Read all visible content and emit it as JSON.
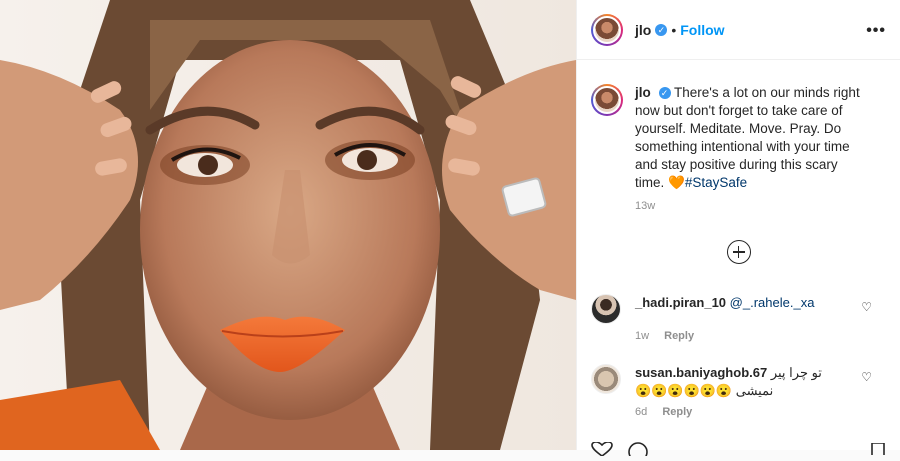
{
  "post": {
    "username": "jlo",
    "verified_mark": "✓",
    "separator": "•",
    "follow_label": "Follow",
    "more_label": "•••",
    "caption_text": "There's a lot on our minds right now but don't forget to take care of yourself. Meditate. Move. Pray. Do something intentional with your time and stay positive during this scary time.",
    "caption_emoji": "🧡",
    "caption_hashtag": "#StaySafe",
    "caption_time": "13w"
  },
  "comments": [
    {
      "username": "_hadi.piran_10",
      "text": "@_.rahele._xa",
      "time": "1w",
      "reply_label": "Reply",
      "like_icon": "heart-outline-icon",
      "like_glyph": "♡"
    },
    {
      "username": "susan.baniyaghob.67",
      "text": "تو چرا پیر نمیشی 😮😮😮😮😮😮",
      "time": "6d",
      "reply_label": "Reply",
      "like_icon": "heart-outline-icon",
      "like_glyph": "♡"
    }
  ],
  "colors": {
    "link_blue": "#0095f6",
    "verified_blue": "#3897f0",
    "lip_orange": "#f06a2a",
    "border": "#efefef"
  },
  "icons": {
    "load_more": "plus-circle-icon",
    "like": "heart-icon",
    "comment": "comment-icon",
    "bookmark": "bookmark-icon"
  }
}
